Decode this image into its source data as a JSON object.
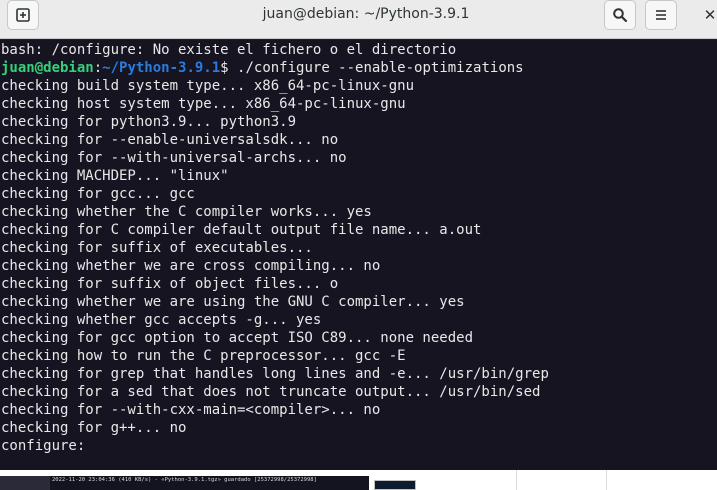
{
  "window": {
    "title": "juan@debian: ~/Python-3.9.1"
  },
  "icons": {
    "new_tab": "new-tab-icon",
    "search": "search-icon",
    "menu": "hamburger-menu-icon",
    "close": "close-icon"
  },
  "colors": {
    "terminal_bg": "#171421",
    "prompt_user": "#33d17a",
    "prompt_path": "#2a7bde",
    "text": "#e8e8e8",
    "titlebar": "#ebebeb"
  },
  "prompt": {
    "user_host": "juan@debian",
    "separator": ":",
    "path": "~/Python-3.9.1",
    "symbol": "$",
    "command": " ./configure --enable-optimizations"
  },
  "output_before": "bash: /configure: No existe el fichero o el directorio",
  "output_lines": [
    "checking build system type... x86_64-pc-linux-gnu",
    "checking host system type... x86_64-pc-linux-gnu",
    "checking for python3.9... python3.9",
    "checking for --enable-universalsdk... no",
    "checking for --with-universal-archs... no",
    "checking MACHDEP... \"linux\"",
    "checking for gcc... gcc",
    "checking whether the C compiler works... yes",
    "checking for C compiler default output file name... a.out",
    "checking for suffix of executables...",
    "checking whether we are cross compiling... no",
    "checking for suffix of object files... o",
    "checking whether we are using the GNU C compiler... yes",
    "checking whether gcc accepts -g... yes",
    "checking for gcc option to accept ISO C89... none needed",
    "checking how to run the C preprocessor... gcc -E",
    "checking for grep that handles long lines and -e... /usr/bin/grep",
    "checking for a sed that does not truncate output... /usr/bin/sed",
    "checking for --with-cxx-main=<compiler>... no",
    "checking for g++... no",
    "configure:"
  ],
  "taskbar": {
    "preview_text": "2022-11-20 23:04:36 (410 KB/s) - «Python-3.9.1.tgz» guardado [25372998/25372998]"
  }
}
